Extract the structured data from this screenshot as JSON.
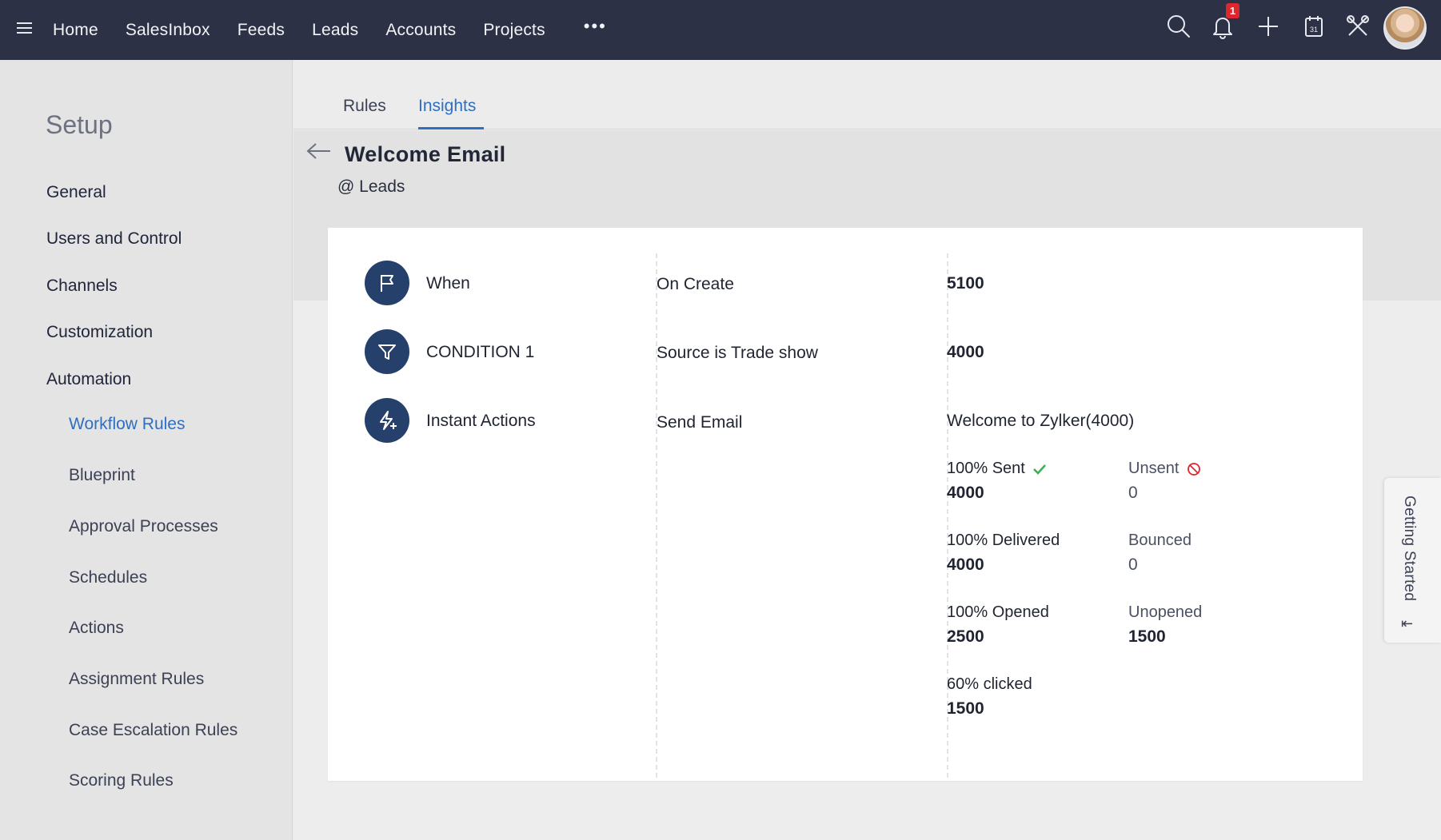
{
  "topbar": {
    "nav": [
      "Home",
      "SalesInbox",
      "Feeds",
      "Leads",
      "Accounts",
      "Projects"
    ],
    "more": "•••",
    "notification_count": "1",
    "icons": [
      "search-icon",
      "bell-icon",
      "plus-icon",
      "calendar-icon",
      "tools-icon",
      "avatar"
    ]
  },
  "sidebar": {
    "title": "Setup",
    "sections": [
      "General",
      "Users and Control",
      "Channels",
      "Customization",
      "Automation"
    ],
    "automation_items": [
      "Workflow Rules",
      "Blueprint",
      "Approval Processes",
      "Schedules",
      "Actions",
      "Assignment Rules",
      "Case Escalation Rules",
      "Scoring Rules"
    ],
    "active_item": "Workflow Rules"
  },
  "tabs": [
    "Rules",
    "Insights"
  ],
  "active_tab": "Insights",
  "header": {
    "title": "Welcome Email",
    "subtitle": "@ Leads"
  },
  "rule": {
    "steps": [
      {
        "label": "When",
        "detail": "On Create",
        "count": "5100",
        "icon": "flag-icon"
      },
      {
        "label": "CONDITION 1",
        "detail": "Source is Trade show",
        "count": "4000",
        "icon": "filter-icon"
      },
      {
        "label": "Instant Actions",
        "detail": "Send Email",
        "count": "Welcome to Zylker(4000)",
        "icon": "lightning-icon"
      }
    ],
    "stats": {
      "sent_label": "100% Sent",
      "sent_value": "4000",
      "unsent_label": "Unsent",
      "unsent_value": "0",
      "delivered_label": "100% Delivered",
      "delivered_value": "4000",
      "bounced_label": "Bounced",
      "bounced_value": "0",
      "opened_label": "100% Opened",
      "opened_value": "2500",
      "unopened_label": "Unopened",
      "unopened_value": "1500",
      "clicked_label": "60% clicked",
      "clicked_value": "1500"
    }
  },
  "getting_started": {
    "label": "Getting Started",
    "arrow": "⇤"
  },
  "colors": {
    "topbar": "#2c3145",
    "accent": "#2e6fbf",
    "step_icon": "#24406b",
    "check": "#3cb054",
    "block": "#e0262d"
  }
}
